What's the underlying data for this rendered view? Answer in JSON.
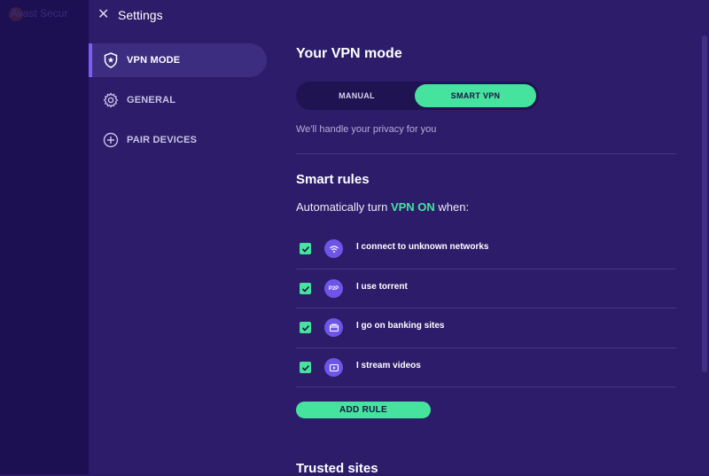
{
  "background_app": {
    "title": "Avast Secur"
  },
  "header": {
    "title": "Settings"
  },
  "sidebar": {
    "items": [
      {
        "label": "VPN MODE",
        "icon": "shield-icon"
      },
      {
        "label": "GENERAL",
        "icon": "gear-icon"
      },
      {
        "label": "PAIR DEVICES",
        "icon": "plus-circle-icon"
      }
    ]
  },
  "vpn_mode": {
    "title": "Your VPN mode",
    "options": [
      "MANUAL",
      "SMART VPN"
    ],
    "selected": "SMART VPN",
    "description": "We'll handle your privacy for you"
  },
  "smart_rules": {
    "title": "Smart rules",
    "subtitle_prefix": "Automatically turn",
    "subtitle_highlight": "VPN ON",
    "subtitle_suffix": "when:",
    "rules": [
      {
        "label": "I connect to unknown networks",
        "icon": "wifi-icon",
        "checked": true
      },
      {
        "label": "I use torrent",
        "icon": "p2p-icon",
        "icon_text": "P2P",
        "checked": true
      },
      {
        "label": "I go on banking sites",
        "icon": "card-icon",
        "checked": true
      },
      {
        "label": "I stream videos",
        "icon": "play-icon",
        "checked": true
      }
    ],
    "add_button": "ADD RULE"
  },
  "trusted_sites": {
    "title": "Trusted sites"
  },
  "colors": {
    "accent": "#45e39e",
    "panel": "#2c1c6a",
    "icon_bg": "#6e55e8"
  }
}
